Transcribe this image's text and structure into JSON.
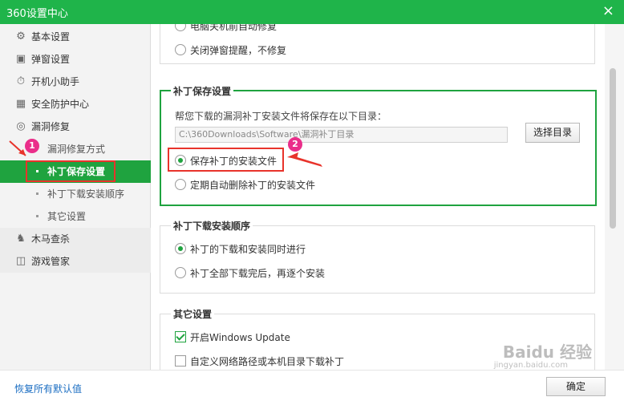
{
  "window": {
    "title": "360设置中心",
    "close": "×"
  },
  "sidebar": {
    "items": [
      {
        "label": "基本设置",
        "icon": "gear-icon"
      },
      {
        "label": "弹窗设置",
        "icon": "window-icon"
      },
      {
        "label": "开机小助手",
        "icon": "timer-icon"
      },
      {
        "label": "安全防护中心",
        "icon": "grid-icon"
      },
      {
        "label": "漏洞修复",
        "icon": "shield-icon"
      }
    ],
    "sub_items": [
      {
        "label": "漏洞修复方式"
      },
      {
        "label": "补丁保存设置"
      },
      {
        "label": "补丁下载安装顺序"
      },
      {
        "label": "其它设置"
      }
    ],
    "items2": [
      {
        "label": "木马查杀",
        "icon": "horse-icon"
      },
      {
        "label": "游戏管家",
        "icon": "gamepad-icon"
      }
    ]
  },
  "content": {
    "top_options": {
      "opt1": "电脑关机前自动修复",
      "opt2": "关闭弹窗提醒，不修复"
    },
    "patch_save": {
      "title": "补丁保存设置",
      "desc": "帮您下载的漏洞补丁安装文件将保存在以下目录：",
      "path": "C:\\360Downloads\\Software\\漏洞补丁目录",
      "choose_btn": "选择目录",
      "opt_keep": "保存补丁的安装文件",
      "opt_delete": "定期自动删除补丁的安装文件"
    },
    "install_order": {
      "title": "补丁下载安装顺序",
      "opt_parallel": "补丁的下载和安装同时进行",
      "opt_sequential": "补丁全部下载完后，再逐个安装"
    },
    "other": {
      "title": "其它设置",
      "opt_wu": "开启Windows Update",
      "opt_custom": "自定义网络路径或本机目录下载补丁"
    }
  },
  "footer": {
    "restore": "恢复所有默认值",
    "ok": "确定"
  },
  "annotations": {
    "badge1": "1",
    "badge2": "2"
  },
  "watermark": {
    "main": "Baidu 经验",
    "sub": "jingyan.baidu.com"
  },
  "colors": {
    "accent": "#1fa33f",
    "title_bar": "#1fb44a",
    "highlight": "#e8332b",
    "badge": "#ea2e8a",
    "link": "#1a6dc2"
  }
}
